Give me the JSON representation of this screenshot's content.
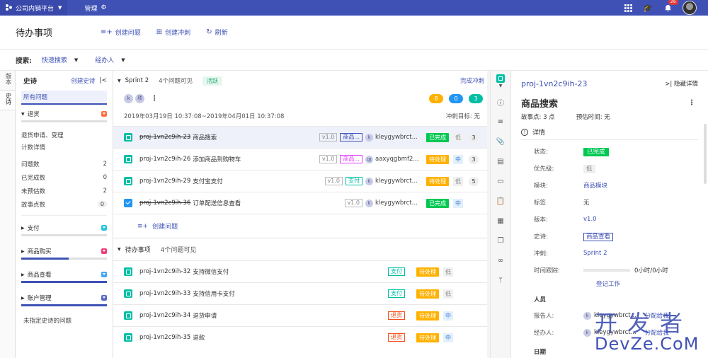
{
  "topbar": {
    "project": "公司内销平台",
    "admin": "管理",
    "notifications": "26"
  },
  "header": {
    "title": "待办事项",
    "create_issue": "创建问题",
    "create_sprint": "创建冲刺",
    "refresh": "刷新"
  },
  "search": {
    "label": "搜索:",
    "quick": "快速搜索",
    "assignee": "经办人"
  },
  "vtabs": [
    {
      "label": "版本"
    },
    {
      "label": "史诗"
    }
  ],
  "epic": {
    "title": "史诗",
    "create": "创建史诗",
    "all": "所有问题",
    "groups": [
      {
        "name": "退货",
        "color": "#ff7043",
        "progress": 0
      },
      {
        "name": "支付",
        "color": "#26c6da",
        "progress": 0
      },
      {
        "name": "商品购买",
        "color": "#ec407a",
        "progress": 0.55
      },
      {
        "name": "商品查看",
        "color": "#42a5f5",
        "progress": 1
      },
      {
        "name": "账户管理",
        "color": "#5c6bc0",
        "progress": 1
      }
    ],
    "detail": {
      "desc1": "退货申请、受理",
      "desc2": "计数详情",
      "rows": [
        {
          "label": "问题数",
          "value": "2"
        },
        {
          "label": "已完成数",
          "value": "0"
        },
        {
          "label": "未预估数",
          "value": "2"
        },
        {
          "label": "故事点数",
          "value": "0"
        }
      ]
    },
    "unassigned": "未指定史诗的问题"
  },
  "sprint": {
    "name": "Sprint 2",
    "count": "4个问题可见",
    "status": "活跃",
    "finish": "完成冲刺",
    "avatars": [
      "k",
      "项"
    ],
    "counters": [
      {
        "value": "8",
        "color": "#ffb100"
      },
      {
        "value": "0",
        "color": "#2196f3"
      },
      {
        "value": "3",
        "color": "#00bfa5"
      }
    ],
    "dates": "2019年03月19日 10:37:08~2019年04月01日 10:37:08",
    "goal": "冲刺目标: 无",
    "issues": [
      {
        "key": "proj-1vn2c9ih-23",
        "title": "商品搜索",
        "strike": true,
        "version": "v1.0",
        "tag": "商品...",
        "tagColor": "blue",
        "avatar": "k",
        "assignee": "kleygywbrct...",
        "status": "已完成",
        "statusType": "done",
        "priority": "低",
        "priorityType": "low",
        "points": "3",
        "type": "story"
      },
      {
        "key": "proj-1vn2c9ih-26",
        "title": "添加商品到购物车",
        "strike": false,
        "version": "v1.0",
        "tag": "商品...",
        "tagColor": "pink",
        "avatar": "项",
        "assignee": "aaxyqgbmf2...",
        "status": "待处理",
        "statusType": "todo",
        "priority": "中",
        "priorityType": "mid",
        "points": "3",
        "type": "story"
      },
      {
        "key": "proj-1vn2c9ih-29",
        "title": "支付宝支付",
        "strike": false,
        "version": "v1.0",
        "tag": "支付",
        "tagColor": "teal",
        "avatar": "k",
        "assignee": "kleygywbrct...",
        "status": "待处理",
        "statusType": "todo",
        "priority": "低",
        "priorityType": "low",
        "points": "5",
        "type": "story"
      },
      {
        "key": "proj-1vn2c9ih-36",
        "title": "订单配送信息查看",
        "strike": true,
        "version": "v1.0",
        "tag": "",
        "tagColor": "",
        "avatar": "k",
        "assignee": "kleygywbrct...",
        "status": "已完成",
        "statusType": "done",
        "priority": "中",
        "priorityType": "mid",
        "points": "",
        "type": "task"
      }
    ],
    "create_issue": "创建问题"
  },
  "backlog": {
    "name": "待办事项",
    "count": "4个问题可见",
    "issues": [
      {
        "key": "proj-1vn2c9ih-32",
        "title": "支持微信支付",
        "tag": "支付",
        "tagColor": "teal",
        "status": "待处理",
        "priority": "低",
        "priorityType": "low"
      },
      {
        "key": "proj-1vn2c9ih-33",
        "title": "支持信用卡支付",
        "tag": "支付",
        "tagColor": "teal",
        "status": "待处理",
        "priority": "低",
        "priorityType": "low"
      },
      {
        "key": "proj-1vn2c9ih-34",
        "title": "退货申请",
        "tag": "退货",
        "tagColor": "red",
        "status": "待处理",
        "priority": "中",
        "priorityType": "mid"
      },
      {
        "key": "proj-1vn2c9ih-35",
        "title": "退款",
        "tag": "退货",
        "tagColor": "red",
        "status": "待处理",
        "priority": "中",
        "priorityType": "mid"
      }
    ]
  },
  "detail": {
    "key": "proj-1vn2c9ih-23",
    "hide": "隐藏详情",
    "title": "商品搜索",
    "points": "故事点: 3 点",
    "estimate": "预估时间: 无",
    "section": "详情",
    "status_label": "状态:",
    "status": "已完成",
    "priority_label": "优先级:",
    "priority": "低",
    "module_label": "模块:",
    "module": "商品模块",
    "labels_label": "标签",
    "labels": "无",
    "version_label": "版本:",
    "version": "v1.0",
    "epic_label": "史诗:",
    "epic": "商品查看",
    "sprint_label": "冲刺:",
    "sprint": "Sprint 2",
    "time_label": "时间跟踪:",
    "time": "0小时/0小时",
    "logwork": "登记工作",
    "people": "人员",
    "reporter_label": "报告人:",
    "reporter": "kleygywbrct...",
    "assign_to_me": "分配给我",
    "assignee_label": "经办人:",
    "assignee": "kleygywbrct...",
    "dates": "日期"
  },
  "watermark": {
    "cn": "开发者",
    "en": "DevZe.CoM"
  }
}
